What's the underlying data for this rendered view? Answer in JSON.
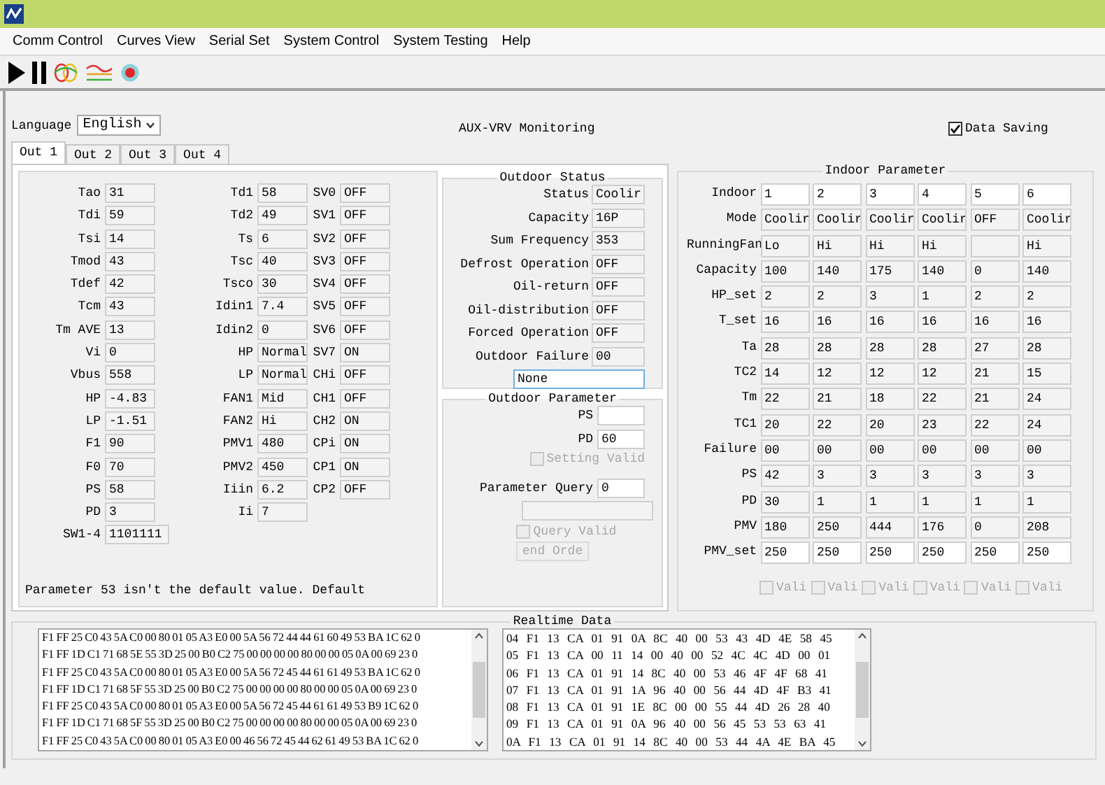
{
  "menu": [
    "Comm Control",
    "Curves View",
    "Serial Set",
    "System Control",
    "System Testing",
    "Help"
  ],
  "language": {
    "label": "Language",
    "value": "English"
  },
  "heading": "AUX-VRV Monitoring",
  "data_saving": {
    "label": "Data Saving",
    "checked": true
  },
  "tabs": [
    {
      "label": "Out 1",
      "selected": true
    },
    {
      "label": "Out 2",
      "selected": false
    },
    {
      "label": "Out 3",
      "selected": false
    },
    {
      "label": "Out 4",
      "selected": false
    }
  ],
  "outdoor_values": [
    [
      {
        "label": "Tao",
        "value": "31"
      },
      {
        "label": "Tdi",
        "value": "59"
      },
      {
        "label": "Tsi",
        "value": "14"
      },
      {
        "label": "Tmod",
        "value": "43"
      },
      {
        "label": "Tdef",
        "value": "42"
      },
      {
        "label": "Tcm",
        "value": "43"
      },
      {
        "label": "Tm AVE",
        "value": "13"
      },
      {
        "label": "Vi",
        "value": "0"
      },
      {
        "label": "Vbus",
        "value": "558"
      },
      {
        "label": "HP",
        "value": "-4.83"
      },
      {
        "label": "LP",
        "value": "-1.51"
      },
      {
        "label": "F1",
        "value": "90"
      },
      {
        "label": "F0",
        "value": "70"
      },
      {
        "label": "PS",
        "value": "58"
      },
      {
        "label": "PD",
        "value": "3"
      },
      {
        "label": "SW1-4",
        "value": "1101111"
      }
    ],
    [
      {
        "label": "Td1",
        "value": "58"
      },
      {
        "label": "Td2",
        "value": "49"
      },
      {
        "label": "Ts",
        "value": "6"
      },
      {
        "label": "Tsc",
        "value": "40"
      },
      {
        "label": "Tsco",
        "value": "30"
      },
      {
        "label": "Idin1",
        "value": "7.4"
      },
      {
        "label": "Idin2",
        "value": "0"
      },
      {
        "label": "HP",
        "value": "Normal"
      },
      {
        "label": "LP",
        "value": "Normal"
      },
      {
        "label": "FAN1",
        "value": "Mid"
      },
      {
        "label": "FAN2",
        "value": "Hi"
      },
      {
        "label": "PMV1",
        "value": "480"
      },
      {
        "label": "PMV2",
        "value": "450"
      },
      {
        "label": "Iiin",
        "value": "6.2"
      },
      {
        "label": "Ii",
        "value": "7"
      }
    ],
    [
      {
        "label": "SV0",
        "value": "OFF"
      },
      {
        "label": "SV1",
        "value": "OFF"
      },
      {
        "label": "SV2",
        "value": "OFF"
      },
      {
        "label": "SV3",
        "value": "OFF"
      },
      {
        "label": "SV4",
        "value": "OFF"
      },
      {
        "label": "SV5",
        "value": "OFF"
      },
      {
        "label": "SV6",
        "value": "OFF"
      },
      {
        "label": "SV7",
        "value": "ON"
      },
      {
        "label": "CHi",
        "value": "OFF"
      },
      {
        "label": "CH1",
        "value": "OFF"
      },
      {
        "label": "CH2",
        "value": "ON"
      },
      {
        "label": "CPi",
        "value": "ON"
      },
      {
        "label": "CP1",
        "value": "ON"
      },
      {
        "label": "CP2",
        "value": "OFF"
      }
    ]
  ],
  "message": "Parameter 53 isn't the default value. Default",
  "outdoor_status": {
    "title": "Outdoor Status",
    "rows": [
      {
        "label": "Status",
        "value": "Coolir"
      },
      {
        "label": "Capacity",
        "value": "16P"
      },
      {
        "label": "Sum Frequency",
        "value": "353"
      },
      {
        "label": "Defrost Operation",
        "value": "OFF"
      },
      {
        "label": "Oil-return",
        "value": "OFF"
      },
      {
        "label": "Oil-distribution",
        "value": "OFF"
      },
      {
        "label": "Forced Operation",
        "value": "OFF"
      },
      {
        "label": "Outdoor Failure",
        "value": "00"
      }
    ],
    "failure_text": {
      "value": "None",
      "focused": true
    }
  },
  "outdoor_parameter": {
    "title": "Outdoor Parameter",
    "fields": [
      {
        "label": "PS"
      },
      {
        "label": "PD",
        "value": "60"
      }
    ],
    "setting_valid": {
      "label": "Setting Valid",
      "checked": false,
      "disabled": true
    },
    "query": {
      "label": "Parameter Query",
      "value": "0"
    },
    "query_valid": {
      "label": "Query Valid",
      "checked": false,
      "disabled": true
    },
    "send_button": {
      "label": "end Orde",
      "disabled": true
    }
  },
  "indoor": {
    "title": "Indoor Parameter",
    "rows": [
      {
        "label": "Indoor",
        "editable": true,
        "values": [
          "1",
          "2",
          "3",
          "4",
          "5",
          "6"
        ]
      },
      {
        "label": "Mode",
        "editable": false,
        "values": [
          "Coolir",
          "Coolir",
          "Coolir",
          "Coolir",
          "OFF",
          "Coolir"
        ]
      },
      {
        "label": "RunningFan",
        "editable": false,
        "cells": [
          {
            "value": "Lo"
          },
          {
            "value": "Hi"
          },
          {
            "value": "Hi"
          },
          {
            "value": "Hi"
          },
          {},
          {
            "value": "Hi"
          }
        ]
      },
      {
        "label": "Capacity",
        "editable": false,
        "values": [
          "100",
          "140",
          "175",
          "140",
          "0",
          "140"
        ]
      },
      {
        "label": "HP_set",
        "editable": false,
        "values": [
          "2",
          "2",
          "3",
          "1",
          "2",
          "2"
        ]
      },
      {
        "label": "T_set",
        "editable": false,
        "values": [
          "16",
          "16",
          "16",
          "16",
          "16",
          "16"
        ]
      },
      {
        "label": "Ta",
        "editable": false,
        "values": [
          "28",
          "28",
          "28",
          "28",
          "27",
          "28"
        ]
      },
      {
        "label": "TC2",
        "editable": false,
        "values": [
          "14",
          "12",
          "12",
          "12",
          "21",
          "15"
        ]
      },
      {
        "label": "Tm",
        "editable": false,
        "values": [
          "22",
          "21",
          "18",
          "22",
          "21",
          "24"
        ]
      },
      {
        "label": "TC1",
        "editable": false,
        "values": [
          "20",
          "22",
          "20",
          "23",
          "22",
          "24"
        ]
      },
      {
        "label": "Failure",
        "editable": false,
        "values": [
          "00",
          "00",
          "00",
          "00",
          "00",
          "00"
        ]
      },
      {
        "label": "PS",
        "editable": false,
        "values": [
          "42",
          "3",
          "3",
          "3",
          "3",
          "3"
        ]
      },
      {
        "label": "PD",
        "editable": false,
        "values": [
          "30",
          "1",
          "1",
          "1",
          "1",
          "1"
        ]
      },
      {
        "label": "PMV",
        "editable": false,
        "values": [
          "180",
          "250",
          "444",
          "176",
          "0",
          "208"
        ]
      },
      {
        "label": "PMV_set",
        "editable": true,
        "values": [
          "250",
          "250",
          "250",
          "250",
          "250",
          "250"
        ]
      }
    ],
    "valid": [
      {
        "label": "Vali",
        "checked": false,
        "disabled": true
      },
      {
        "label": "Vali",
        "checked": false,
        "disabled": true
      },
      {
        "label": "Vali",
        "checked": false,
        "disabled": true
      },
      {
        "label": "Vali",
        "checked": false,
        "disabled": true
      },
      {
        "label": "Vali",
        "checked": false,
        "disabled": true
      },
      {
        "label": "Vali",
        "checked": false,
        "disabled": true
      }
    ]
  },
  "realtime": {
    "title": "Realtime Data",
    "left_lines": [
      "F1 FF 25 C0 43 5A C0 00 80 01 05 A3 E0 00 5A 56 72 44 44 61 60 49 53 BA 1C 62 0",
      "F1 FF 1D C1 71 68 5E 55 3D 25 00 B0 C2 75 00 00 00 00 80 00 00 05 0A 00 69 23 0",
      "F1 FF 25 C0 43 5A C0 00 80 01 05 A3 E0 00 5A 56 72 45 44 61 61 49 53 BA 1C 62 0",
      "F1 FF 1D C1 71 68 5F 55 3D 25 00 B0 C2 75 00 00 00 00 80 00 00 05 0A 00 69 23 0",
      "F1 FF 25 C0 43 5A C0 00 80 01 05 A3 E0 00 5A 56 72 45 44 61 61 49 53 B9 1C 62 0",
      "F1 FF 1D C1 71 68 5F 55 3D 25 00 B0 C2 75 00 00 00 00 80 00 00 05 0A 00 69 23 0",
      "F1 FF 25 C0 43 5A C0 00 80 01 05 A3 E0 00 46 56 72 45 44 62 61 49 53 BA 1C 62 0"
    ],
    "right_lines": [
      "04 F1 13 CA 01 91 0A 8C 40 00 53 43 4D 4E 58 45",
      "05 F1 13 CA 00 11 14 00 40 00 52 4C 4C 4D 00 01",
      "06 F1 13 CA 01 91 14 8C 40 00 53 46 4F 4F 68 41",
      "07 F1 13 CA 01 91 1A 96 40 00 56 44 4D 4F B3 41",
      "08 F1 13 CA 01 91 1E 8C 00 00 55 44 4D 26 28 40",
      "09 F1 13 CA 01 91 0A 96 40 00 56 45 53 53 63 41",
      "0A F1 13 CA 01 91 14 8C 40 00 53 44 4A 4E BA 45"
    ]
  }
}
